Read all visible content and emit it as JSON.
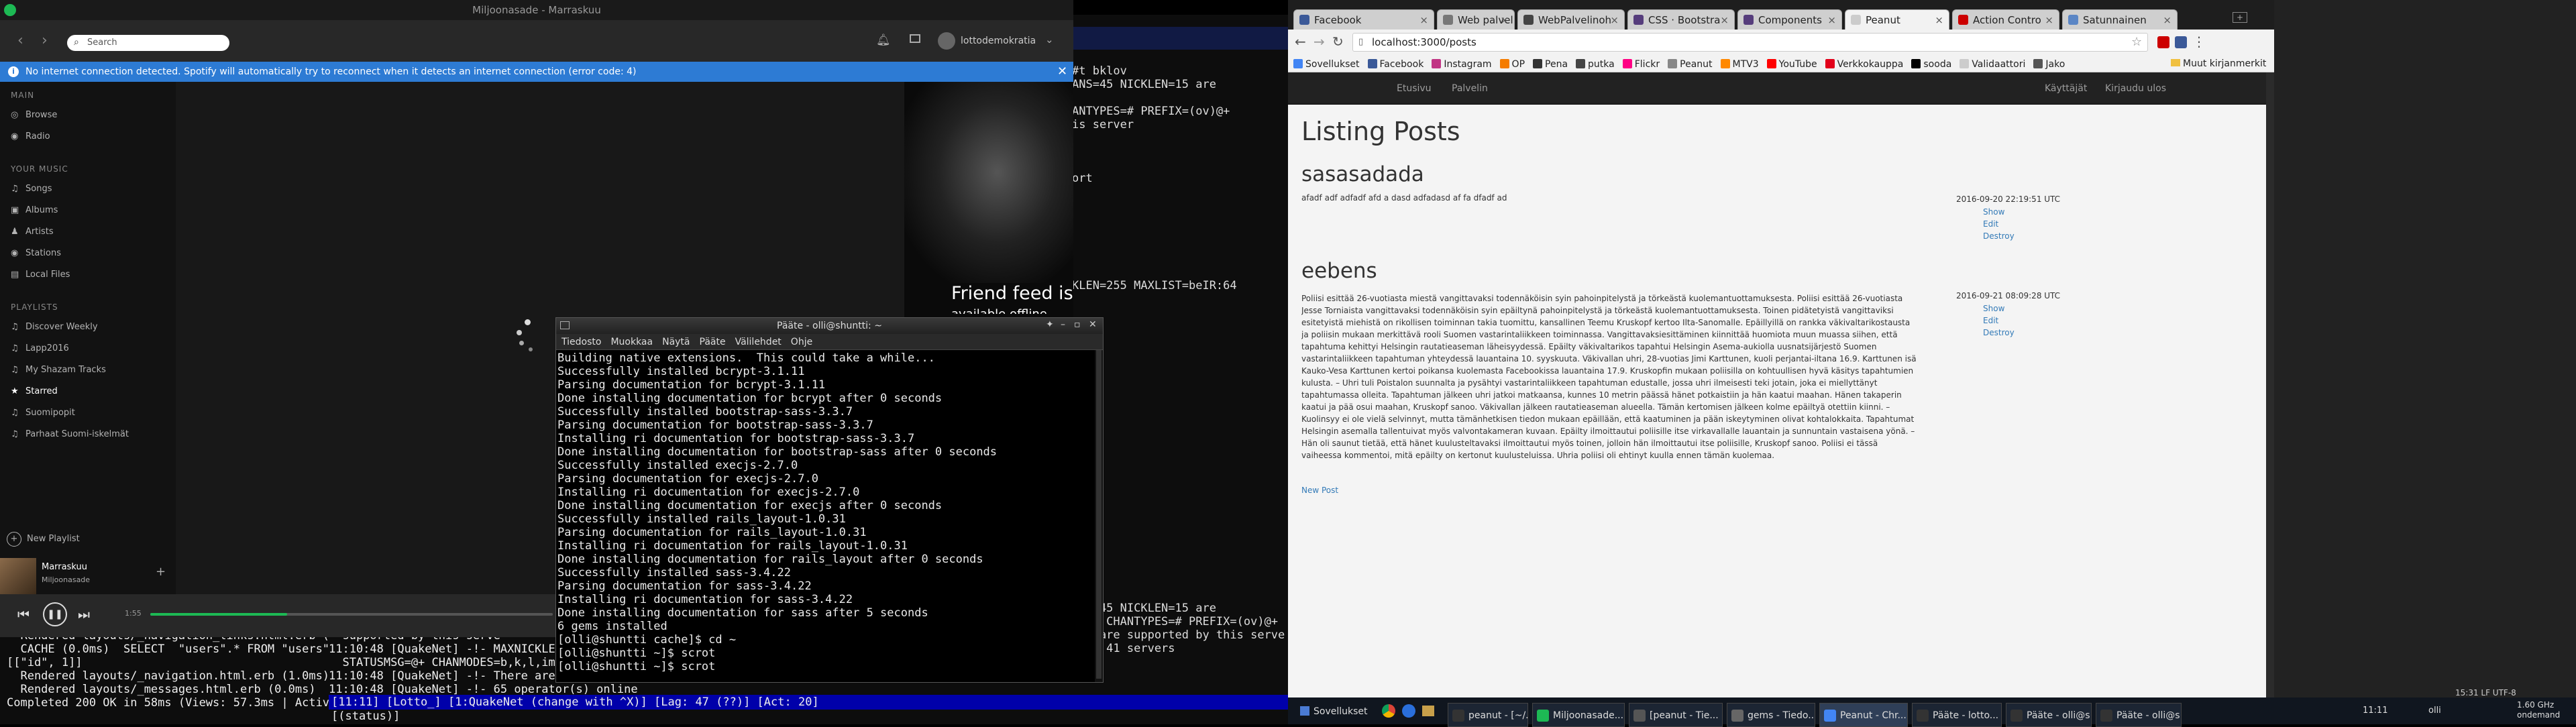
{
  "spotify": {
    "window_title": "Miljoonasade - Marraskuu",
    "search_placeholder": "Search",
    "user_name": "lottodemokratia",
    "banner": "No internet connection detected. Spotify will automatically try to reconnect when it detects an internet connection (error code: 4)",
    "main_header": "MAIN",
    "main_items": [
      {
        "label": "Browse",
        "icon": "browse-icon"
      },
      {
        "label": "Radio",
        "icon": "radio-icon"
      }
    ],
    "music_header": "YOUR MUSIC",
    "music_items": [
      {
        "label": "Songs"
      },
      {
        "label": "Albums"
      },
      {
        "label": "Artists"
      },
      {
        "label": "Stations"
      },
      {
        "label": "Local Files"
      }
    ],
    "playlists_header": "PLAYLISTS",
    "playlists": [
      "Discover Weekly",
      "Lapp2016",
      "My Shazam Tracks",
      "Starred",
      "Suomipopit",
      "Parhaat Suomi-iskelmät"
    ],
    "new_playlist": "New Playlist",
    "now_playing_track": "Marraskuu",
    "now_playing_artist": "Miljoonasade",
    "elapsed": "1:55",
    "progress_fraction": 0.34,
    "friend_feed": "Friend feed is",
    "friend_feed_sub": "available offline"
  },
  "terminal": {
    "title": "Pääte - olli@shuntti: ~",
    "menu": [
      "Tiedosto",
      "Muokkaa",
      "Näytä",
      "Pääte",
      "Välilehdet",
      "Ohje"
    ],
    "lines": [
      "Building native extensions.  This could take a while...",
      "Successfully installed bcrypt-3.1.11",
      "Parsing documentation for bcrypt-3.1.11",
      "Done installing documentation for bcrypt after 0 seconds",
      "Successfully installed bootstrap-sass-3.3.7",
      "Parsing documentation for bootstrap-sass-3.3.7",
      "Installing ri documentation for bootstrap-sass-3.3.7",
      "Done installing documentation for bootstrap-sass after 0 seconds",
      "Successfully installed execjs-2.7.0",
      "Parsing documentation for execjs-2.7.0",
      "Installing ri documentation for execjs-2.7.0",
      "Done installing documentation for execjs after 0 seconds",
      "Successfully installed rails_layout-1.0.31",
      "Parsing documentation for rails_layout-1.0.31",
      "Installing ri documentation for rails_layout-1.0.31",
      "Done installing documentation for rails_layout after 0 seconds",
      "Successfully installed sass-3.4.22",
      "Parsing documentation for sass-3.4.22",
      "Installing ri documentation for sass-3.4.22",
      "Done installing documentation for sass after 5 seconds",
      "6 gems installed",
      "[olli@shuntti cache]$ cd ~",
      "[olli@shuntti ~]$ scrot",
      "[olli@shuntti ~]$ scrot"
    ]
  },
  "irc": {
    "right_lines": [
      "#t bklov",
      "ANS=45 NICKLEN=15 are",
      "",
      "ANTYPES=# PREFIX=(ov)@+",
      "is server",
      "",
      "",
      "",
      "ort",
      "",
      "",
      "",
      "",
      "",
      "",
      "",
      "KLEN=255 MAXLIST=beIR:64"
    ],
    "lower_right": [
      "ANS=45 NICKLEN=15 are",
      "=200 CHANTYPES=# PREFIX=(ov)@+",
      "ket are supported by this server",
      "e on 41 servers"
    ],
    "log_lines": [
      "  Rendered layouts/_navigation_links.html.erb (0.",
      "  CACHE (0.0ms)  SELECT  \"users\".* FROM \"users\"",
      "[[\"id\", 1]]",
      "  Rendered layouts/_navigation.html.erb (1.0ms)",
      "  Rendered layouts/_messages.html.erb (0.0ms)",
      "Completed 200 OK in 58ms (Views: 57.3ms | ActiveR"
    ],
    "mid_lines": [
      "  supported by this serve",
      "11:10:48 [QuakeNet] -!- MAXNICKLEN=15 TOPICLEN=250 KICKLEN=255 CHANNELLEN=200 CHANTYPES=# PREFIX=(ov)@+",
      "  STATUSMSG=@+ CHANMODES=b,k,l,imnpstrDducCNMT CASEMAPPING=rfc1459 NETWORK=QuakeNet are supported by this server",
      "11:10:48 [QuakeNet] -!- There are 1 users and 45398 invisible on 41 servers",
      "11:10:48 [QuakeNet] -!- 65 operator(s) online"
    ],
    "statusbar": "[11:11] [Lotto_] [1:QuakeNet (change with ^X)] [Lag: 47 (??)] [Act: 20]",
    "status": "[(status)]"
  },
  "browser": {
    "tabs": [
      {
        "label": "Facebook",
        "color": "#3b5998"
      },
      {
        "label": "Web palveline",
        "color": "#777777"
      },
      {
        "label": "WebPalvelinoh",
        "color": "#444444"
      },
      {
        "label": "CSS · Bootstra",
        "color": "#563d7c"
      },
      {
        "label": "Components",
        "color": "#563d7c"
      },
      {
        "label": "Peanut",
        "color": "#cccccc"
      },
      {
        "label": "Action Contro",
        "color": "#cc0000"
      },
      {
        "label": "Satunnainen",
        "color": "#5b86c5"
      }
    ],
    "url": "localhost:3000/posts",
    "bookmarks": [
      {
        "label": "Sovellukset",
        "color": "#4285f4"
      },
      {
        "label": "Facebook",
        "color": "#3b5998"
      },
      {
        "label": "Instagram",
        "color": "#c13584"
      },
      {
        "label": "OP",
        "color": "#f57c00"
      },
      {
        "label": "Pena",
        "color": "#333333"
      },
      {
        "label": "putka",
        "color": "#444444"
      },
      {
        "label": "Flickr",
        "color": "#ff0084"
      },
      {
        "label": "Peanut",
        "color": "#888888"
      },
      {
        "label": "MTV3",
        "color": "#ff8800"
      },
      {
        "label": "YouTube",
        "color": "#ff0000"
      },
      {
        "label": "Verkkokauppa",
        "color": "#e2001a"
      },
      {
        "label": "sooda",
        "color": "#000000"
      },
      {
        "label": "Validaattori",
        "color": "#cccccc"
      },
      {
        "label": "Jako",
        "color": "#555555"
      }
    ],
    "other_bookmarks": "Muut kirjanmerkit",
    "navbar_left": [
      "Etusivu",
      "Palvelin"
    ],
    "navbar_right": [
      "Käyttäjät",
      "Kirjaudu ulos"
    ],
    "page_title": "Listing Posts",
    "posts": [
      {
        "title": "sasasadada",
        "body": "afadf adf adfadf afd a dasd adfadasd af fa dfadf ad",
        "date": "2016-09-20 22:19:51 UTC",
        "actions": [
          "Show",
          "Edit",
          "Destroy"
        ]
      },
      {
        "title": "eebens",
        "body": "Poliisi esittää 26-vuotiasta miestä vangittavaksi todennäköisin syin pahoinpitelystä ja törkeästä kuolemantuottamuksesta. Poliisi esittää 26-vuotiasta Jesse Torniaista vangittavaksi todennäköisin syin epäiltynä pahoinpitelystä ja törkeästä kuolemantuottamuksesta. Toinen pidätetyistä vangittaviksi esitetyistä miehistä on rikollisen toiminnan takia tuomittu, kansallinen Teemu Kruskopf kertoo Ilta-Sanomalle. Epäillyillä on rankka väkivaltarikostausta ja poliisin mukaan merkittävä rooli Suomen vastarintaliikkeen toiminnassa. Vangittavaksiesittäminen kiinnittää huomiota muun muassa siihen, että tapahtuma kehittyi Helsingin rautatieaseman läheisyydessä. Epäilty väkivaltarikos tapahtui Helsingin Asema-aukiolla uusnatsijärjestö Suomen vastarintaliikkeen tapahtuman yhteydessä lauantaina 10. syyskuuta. Väkivallan uhri, 28-vuotias Jimi Karttunen, kuoli perjantai-iltana 16.9. Karttunen isä Kauko-Vesa Karttunen kertoi poikansa kuolemasta Facebookissa lauantaina 17.9. Kruskopfin mukaan poliisilla on kohtuullisen hyvä käsitys tapahtumien kulusta. – Uhri tuli Poistalon suunnalta ja pysähtyi vastarintaliikkeen tapahtuman edustalle, jossa uhri ilmeisesti teki jotain, joka ei miellyttänyt tapahtumassa olleita. Tapahtuman jälkeen uhri jatkoi matkaansa, kunnes 10 metrin päässä hänet potkaistiin ja hän kaatui maahan. Hänen takaperin kaatui ja pää osui maahan, Kruskopf sanoo. Väkivallan jälkeen rautatieaseman alueella. Tämän kertomisen jälkeen kolme epäiltyä otettiin kiinni. – Kuolinsyy ei ole vielä selvinnyt, mutta tämänhetkisen tiedon mukaan epäillään, että kaatuminen ja pään iskeytyminen olivat kohtalokkaita. Tapahtumat Helsingin asemalla tallentuivat myös valvontakameran kuvaan. Epäilty ilmoittautui poliisille itse virkavallalle lauantain ja sunnuntain vastaisena yönä. – Hän oli saunut tietää, että hänet kuulusteltavaksi ilmoittautui myös toinen, jolloin hän ilmoittautui itse poliisille, Kruskopf sanoo. Poliisi ei tässä vaiheessa kommentoi, mitä epäilty on kertonut kuulusteluissa. Uhria poliisi oli ehtinyt kuulla ennen tämän kuolemaa.",
        "date": "2016-09-21 08:09:28 UTC",
        "actions": [
          "Show",
          "Edit",
          "Destroy"
        ]
      }
    ],
    "new_post": "New Post"
  },
  "taskbar": {
    "start": "Sovellukset",
    "tasks": [
      {
        "label": "peanut - [~/...",
        "color": "#333333"
      },
      {
        "label": "Miljoonasade...",
        "color": "#1db954"
      },
      {
        "label": "[peanut - Tie...",
        "color": "#555555"
      },
      {
        "label": "gems - Tiedo...",
        "color": "#666666"
      },
      {
        "label": "Peanut - Chr...",
        "color": "#4285f4"
      },
      {
        "label": "Pääte - lotto...",
        "color": "#333333"
      },
      {
        "label": "Pääte - olli@s...",
        "color": "#333333"
      },
      {
        "label": "Pääte - olli@s...",
        "color": "#333333"
      }
    ],
    "clock": "11:11",
    "user": "olli",
    "sys_time": "1.60 GHz"
  },
  "right_strip": {
    "top": "15:31  LF  UTF-8",
    "bottom": "1.60 GHz ondemand"
  }
}
